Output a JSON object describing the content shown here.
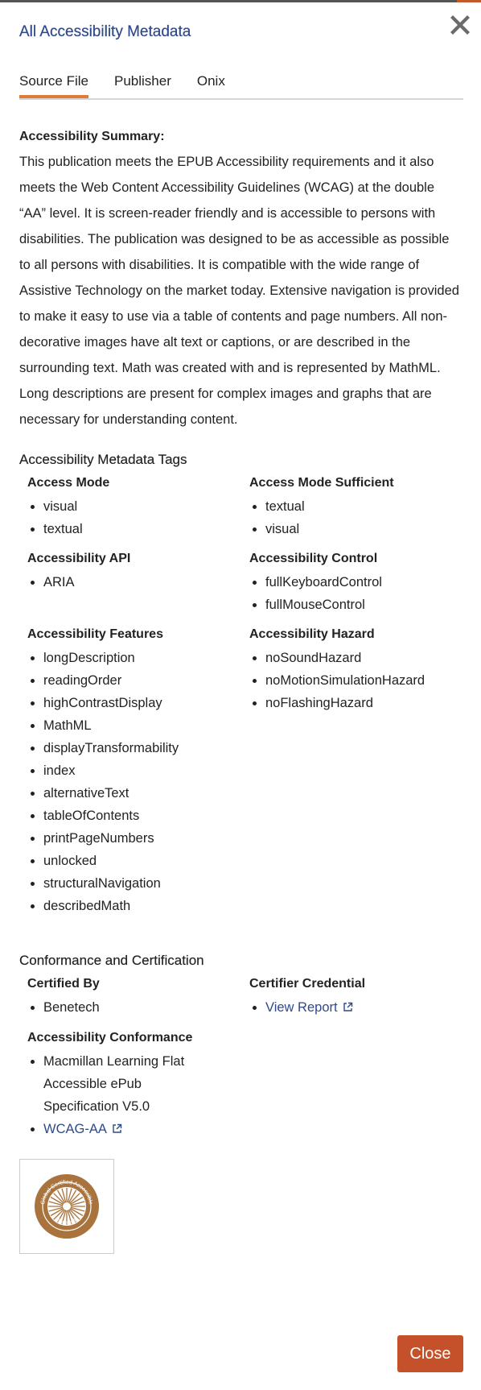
{
  "modal": {
    "title": "All Accessibility Metadata",
    "close_icon": "close-x-icon"
  },
  "tabs": [
    {
      "label": "Source File",
      "active": true
    },
    {
      "label": "Publisher",
      "active": false
    },
    {
      "label": "Onix",
      "active": false
    }
  ],
  "summary": {
    "heading": "Accessibility Summary:",
    "text": "This publication meets the EPUB Accessibility requirements and it also meets the Web Content Accessibility Guidelines (WCAG) at the double “AA” level. It is screen-reader friendly and is accessible to persons with disabilities. The publication was designed to be as accessible as possible to all persons with disabilities. It is compatible with the wide range of Assistive Technology on the market today. Extensive navigation is provided to make it easy to use via a table of contents and page numbers. All non-decorative images have alt text or captions, or are described in the surrounding text. Math was created with and is represented by MathML. Long descriptions are present for complex images and graphs that are necessary for understanding content."
  },
  "metadata_tags": {
    "heading": "Accessibility Metadata Tags",
    "access_mode": {
      "title": "Access Mode",
      "items": [
        "visual",
        "textual"
      ]
    },
    "access_mode_sufficient": {
      "title": "Access Mode Sufficient",
      "items": [
        "textual",
        "visual"
      ]
    },
    "accessibility_api": {
      "title": "Accessibility API",
      "items": [
        "ARIA"
      ]
    },
    "accessibility_control": {
      "title": "Accessibility Control",
      "items": [
        "fullKeyboardControl",
        "fullMouseControl"
      ]
    },
    "accessibility_features": {
      "title": "Accessibility Features",
      "items": [
        "longDescription",
        "readingOrder",
        "highContrastDisplay",
        "MathML",
        "displayTransformability",
        "index",
        "alternativeText",
        "tableOfContents",
        "printPageNumbers",
        "unlocked",
        "structuralNavigation",
        "describedMath"
      ]
    },
    "accessibility_hazard": {
      "title": "Accessibility Hazard",
      "items": [
        "noSoundHazard",
        "noMotionSimulationHazard",
        "noFlashingHazard"
      ]
    }
  },
  "conformance": {
    "heading": "Conformance and Certification",
    "certified_by": {
      "title": "Certified By",
      "items": [
        "Benetech"
      ]
    },
    "certifier_credential": {
      "title": "Certifier Credential",
      "link_label": "View Report"
    },
    "accessibility_conformance": {
      "title": "Accessibility Conformance",
      "text_item": "Macmillan Learning Flat Accessible ePub Specification V5.0",
      "link_label": "WCAG-AA"
    },
    "badge": {
      "top_text": "Global Certified Accessible",
      "bottom_text": "Benetech",
      "color": "#a8733d"
    }
  },
  "footer": {
    "close_label": "Close"
  },
  "colors": {
    "title": "#2e4a8a",
    "tab_active_underline": "#e07b3a",
    "close_button": "#c4512a",
    "link": "#2e4a8a"
  }
}
